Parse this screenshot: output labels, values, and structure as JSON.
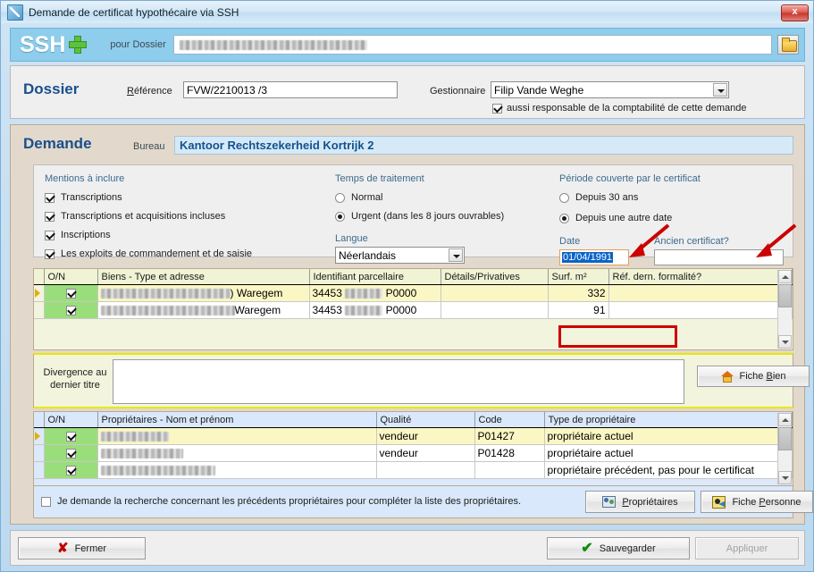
{
  "window": {
    "title": "Demande de certificat hypothécaire via SSH",
    "close_label": "x",
    "icon": "app-icon"
  },
  "banner": {
    "logo": "SSH",
    "plus_icon": "green-plus-icon",
    "for_dossier_label": "pour Dossier",
    "dossier_value": "",
    "folder_icon": "folder-open-icon"
  },
  "dossier": {
    "title": "Dossier",
    "reference_label": "Référence",
    "reference_value": "FVW/2210013 /3",
    "manager_label": "Gestionnaire",
    "manager_value": "Filip Vande Weghe",
    "also_responsible_label": "aussi responsable de la comptabilité de cette demande",
    "also_responsible_checked": true
  },
  "demande": {
    "title": "Demande",
    "bureau_label": "Bureau",
    "bureau_value": "Kantoor Rechtszekerheid Kortrijk 2",
    "mentions": {
      "group_label": "Mentions à inclure",
      "items": [
        {
          "label": "Transcriptions",
          "checked": true
        },
        {
          "label": "Transcriptions et acquisitions incluses",
          "checked": true
        },
        {
          "label": "Inscriptions",
          "checked": true
        },
        {
          "label": "Les exploits de commandement et de saisie",
          "checked": true
        }
      ]
    },
    "temps": {
      "group_label": "Temps de traitement",
      "options": [
        {
          "label": "Normal",
          "selected": false
        },
        {
          "label": "Urgent (dans les 8 jours ouvrables)",
          "selected": true
        }
      ],
      "langue_label": "Langue",
      "langue_value": "Néerlandais"
    },
    "periode": {
      "group_label": "Période couverte par le certificat",
      "options": [
        {
          "label": "Depuis 30 ans",
          "selected": false
        },
        {
          "label": "Depuis une autre date",
          "selected": true
        }
      ],
      "date_label": "Date",
      "date_value": "01/04/1991",
      "date_selected": true,
      "ancien_label": "Ancien certificat?",
      "ancien_value": ""
    },
    "highlight_color": "#cc0000",
    "arrow_color": "#cc0000"
  },
  "biens_table": {
    "columns": [
      "O/N",
      "Biens - Type et adresse",
      "Identifiant parcellaire",
      "Détails/Privatives",
      "Surf. m²",
      "Réf. dern. formalité?"
    ],
    "rows": [
      {
        "selected": true,
        "on": true,
        "address_suffix": ") Waregem",
        "parcel_prefix": "34453",
        "parcel_suffix": "P0000",
        "details": "",
        "surface": "332",
        "ref": ""
      },
      {
        "selected": false,
        "on": true,
        "address_suffix": "Waregem",
        "parcel_prefix": "34453",
        "parcel_suffix": "P0000",
        "details": "",
        "surface": "91",
        "ref": ""
      }
    ]
  },
  "divergence": {
    "label_line1": "Divergence au",
    "label_line2": "dernier titre",
    "value": "",
    "fiche_bien_label": "Fiche Bien",
    "fiche_bien_mnemonic": "B",
    "fiche_bien_icon": "house-icon"
  },
  "props_table": {
    "columns": [
      "O/N",
      "Propriétaires - Nom et prénom",
      "Qualité",
      "Code",
      "Type de propriétaire"
    ],
    "rows": [
      {
        "selected": true,
        "on": true,
        "quality": "vendeur",
        "code": "P01427",
        "type": "propriétaire actuel"
      },
      {
        "selected": false,
        "on": true,
        "quality": "vendeur",
        "code": "P01428",
        "type": "propriétaire actuel"
      },
      {
        "selected": false,
        "on": true,
        "quality": "",
        "code": "",
        "type": "propriétaire précédent, pas pour le certificat"
      }
    ]
  },
  "props_footer": {
    "search_prev_label": "Je demande la recherche concernant les précédents propriétaires pour compléter la liste des propriétaires.",
    "search_prev_checked": false,
    "proprietaires_label": "Propriétaires",
    "proprietaires_icon": "people-icon",
    "fiche_personne_label": "Fiche Personne",
    "fiche_personne_icon": "id-card-icon"
  },
  "footer": {
    "fermer_label": "Fermer",
    "fermer_icon": "red-x-icon",
    "sauvegarder_label": "Sauvegarder",
    "sauvegarder_icon": "green-check-icon",
    "appliquer_label": "Appliquer",
    "appliquer_enabled": false
  }
}
